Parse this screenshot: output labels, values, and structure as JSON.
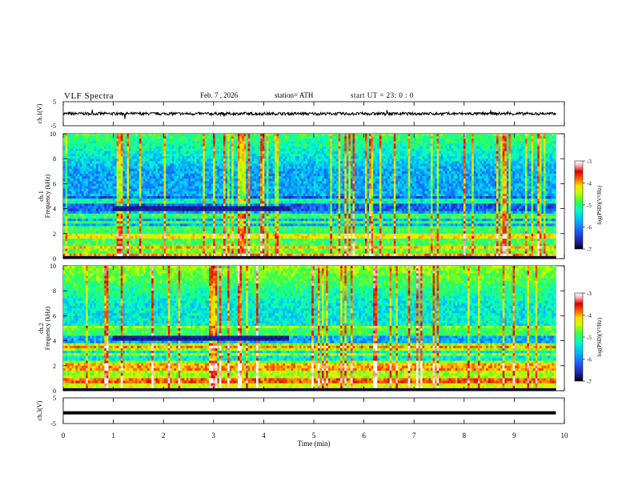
{
  "header": {
    "title": "VLF Spectra",
    "date": "Feb. 7 , 2026",
    "station": "station= ATH",
    "start_ut": "start UT = 23: 0 : 0"
  },
  "colors": {
    "spectrogram_scale": [
      "#000000",
      "#1e1ea0",
      "#1e5aff",
      "#00b4ff",
      "#00ffc8",
      "#3cff3c",
      "#c8ff00",
      "#ffdc00",
      "#ff5a00",
      "#dc0000",
      "#ffb4b4",
      "#ffffff"
    ],
    "waveform": "#000000"
  },
  "chart_data": [
    {
      "type": "line",
      "name": "ch1-waveform",
      "ylabel": "ch.1(V)",
      "ylim": [
        -5,
        5
      ],
      "yticks": [
        "5",
        "-5"
      ],
      "x_range": [
        0,
        9.83
      ],
      "approx_level": 0,
      "approx_amplitude": 0.6
    },
    {
      "type": "heatmap",
      "name": "ch1-spectrogram",
      "ylabel": "ch.1\nFrequency (kHz)",
      "ylim": [
        0,
        10
      ],
      "yticks": [
        "0",
        "2",
        "4",
        "6",
        "8",
        "10"
      ],
      "x_range": [
        0,
        9.83
      ],
      "colorbar": {
        "label": "log(PSD)(V²/Hz)",
        "range": [
          -7,
          -3
        ],
        "ticks": [
          "-3",
          "-4",
          "-5",
          "-6",
          "-7"
        ]
      },
      "notable_bands_khz": [
        0.3,
        0.9,
        1.8,
        2.4,
        2.9,
        3.4,
        4.6
      ],
      "dark_block": {
        "t_min": [
          1.0,
          4.5
        ],
        "f_khz": [
          3.9,
          4.3
        ]
      }
    },
    {
      "type": "heatmap",
      "name": "ch2-spectrogram",
      "ylabel": "ch.2\nFrequency (kHz)",
      "ylim": [
        0,
        10
      ],
      "yticks": [
        "0",
        "2",
        "4",
        "6",
        "8",
        "10"
      ],
      "x_range": [
        0,
        9.83
      ],
      "colorbar": {
        "label": "log(PSD)(V²/Hz)",
        "range": [
          -7,
          -3
        ],
        "ticks": [
          "-3",
          "-4",
          "-5",
          "-6",
          "-7"
        ]
      },
      "notable_bands_khz": [
        0.8,
        1.8,
        2.2,
        2.9,
        3.4,
        3.6,
        4.6,
        5.0
      ],
      "dark_block": {
        "t_min": [
          1.0,
          4.5
        ],
        "f_khz": [
          4.1,
          4.4
        ]
      }
    },
    {
      "type": "line",
      "name": "ch3-waveform",
      "ylabel": "ch.3(V)",
      "ylim": [
        -5,
        5
      ],
      "yticks": [
        "5",
        "-5"
      ],
      "x_range": [
        0,
        9.83
      ],
      "approx_level": -0.8,
      "xlabel": "Time (min)",
      "xlim": [
        0,
        10
      ],
      "xticks": [
        "0",
        "1",
        "2",
        "3",
        "4",
        "5",
        "6",
        "7",
        "8",
        "9",
        "10"
      ]
    }
  ]
}
